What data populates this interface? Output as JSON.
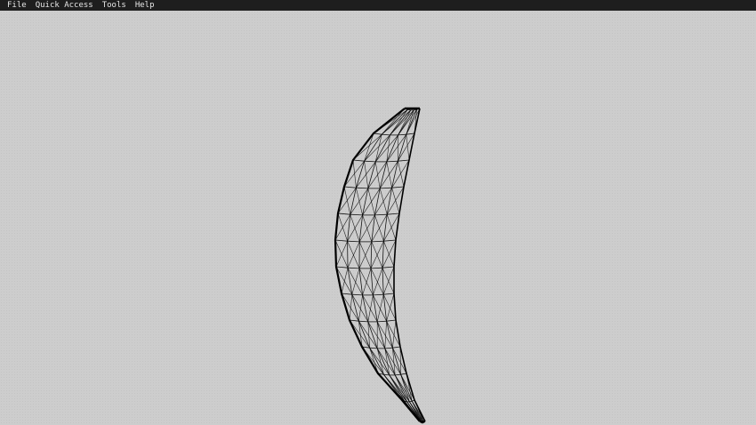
{
  "menubar": {
    "items": [
      {
        "id": "file",
        "label": "File"
      },
      {
        "id": "quick-access",
        "label": "Quick Access"
      },
      {
        "id": "tools",
        "label": "Tools"
      },
      {
        "id": "help",
        "label": "Help"
      }
    ]
  },
  "viewport": {
    "model_icon": "wireframe-blade-mesh",
    "background_color": "#cdcdcd",
    "wire_color": "#000000",
    "menubar_color": "#1e1e1e"
  }
}
